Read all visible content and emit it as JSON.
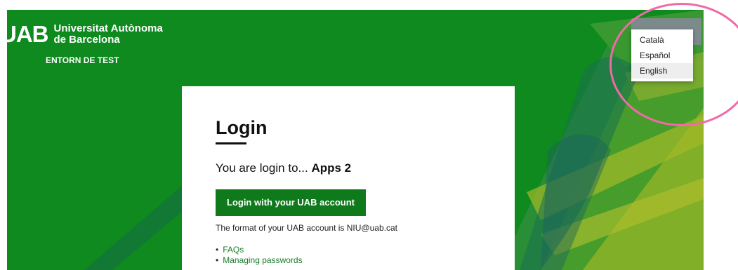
{
  "header": {
    "logo_mark": "UAB",
    "university_line1": "Universitat Autònoma",
    "university_line2": "de Barcelona",
    "environment": "ENTORN DE TEST"
  },
  "language_menu": {
    "items": [
      {
        "label": "Català",
        "active": false
      },
      {
        "label": "Español",
        "active": false
      },
      {
        "label": "English",
        "active": true
      }
    ]
  },
  "login": {
    "title": "Login",
    "lead_prefix": "You are login to...",
    "app_name": "Apps 2",
    "button_label": "Login with your UAB account",
    "hint": "The format of your UAB account is NIU@uab.cat",
    "links": [
      {
        "label": "FAQs"
      },
      {
        "label": "Managing passwords"
      }
    ]
  },
  "colors": {
    "brand_green": "#0e8a1f",
    "button_green": "#0e7a1c",
    "link_green": "#1a7a2a",
    "highlight_pink": "#f06aa7"
  }
}
